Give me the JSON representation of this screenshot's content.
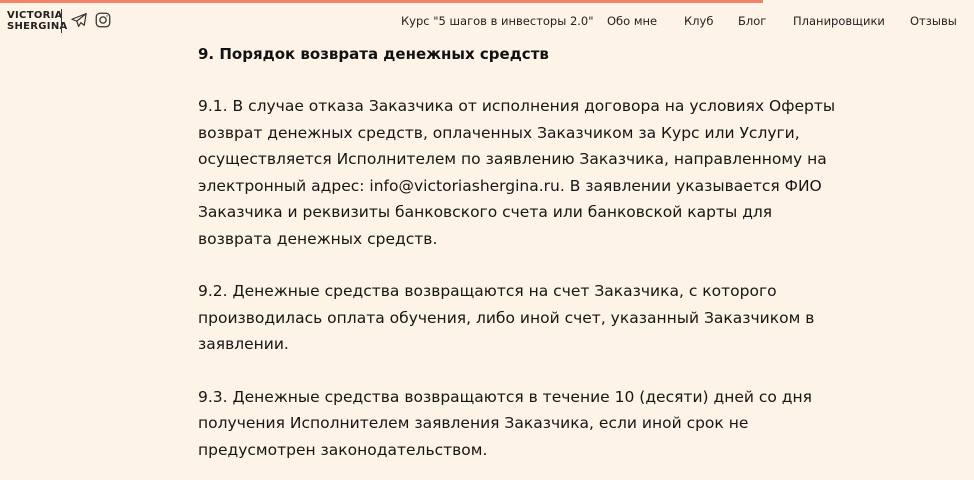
{
  "brand": {
    "line1": "VICTORIA",
    "line2": "SHERGINA",
    "accent_color": "#f4836a",
    "background_color": "#fdf3e6"
  },
  "social": {
    "telegram_icon": "telegram-icon",
    "instagram_icon": "instagram-icon"
  },
  "nav": {
    "course": "Курс \"5 шагов в инвесторы 2.0\"",
    "about": "Обо мне",
    "club": "Клуб",
    "blog": "Блог",
    "planners": "Планировщики",
    "reviews": "Отзывы"
  },
  "document": {
    "section_title": "9. Порядок возврата денежных средств",
    "p1": "9.1. В случае отказа Заказчика от исполнения договора на условиях Оферты возврат денежных средств, оплаченных Заказчиком за Курс или Услуги, осуществляется Исполнителем по заявлению Заказчика, направленному на электронный адрес: info@victoriashergina.ru. В заявлении указывается ФИО Заказчика и реквизиты банковского счета или банковской карты для возврата денежных средств.",
    "p2": "9.2. Денежные средства возвращаются на счет Заказчика, с которого производилась оплата обучения, либо иной счет, указанный Заказчиком в заявлении.",
    "p3": "9.3. Денежные средства возвращаются в течение 10 (десяти) дней со дня получения Исполнителем заявления Заказчика, если иной срок не предусмотрен законодательством."
  }
}
